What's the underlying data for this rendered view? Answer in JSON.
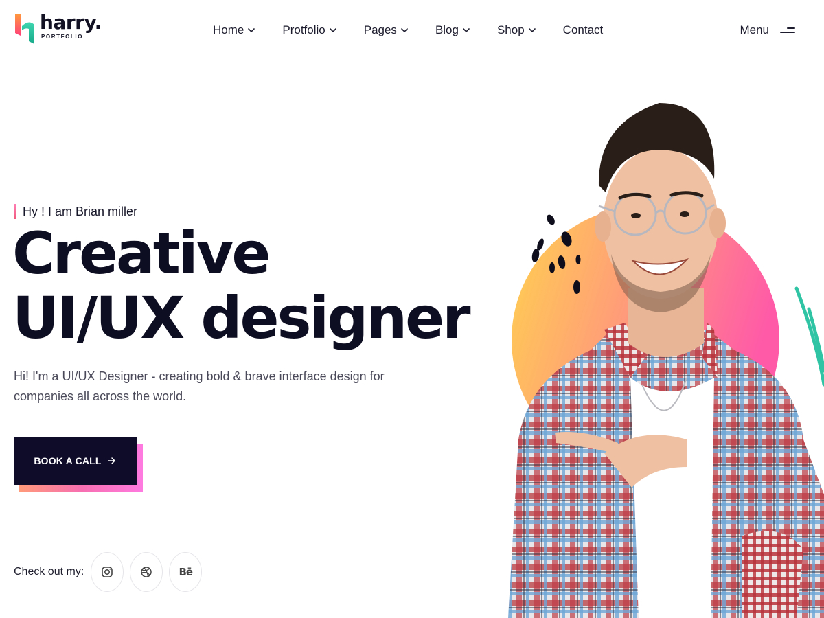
{
  "brand": {
    "name": "harry.",
    "tagline": "PORTFOLIO",
    "colors": {
      "mark_left": "#ff5a7a",
      "mark_right": "#24c2a0",
      "dark": "#0f0c29"
    }
  },
  "nav": {
    "items": [
      {
        "label": "Home",
        "has_dropdown": true
      },
      {
        "label": "Protfolio",
        "has_dropdown": true
      },
      {
        "label": "Pages",
        "has_dropdown": true
      },
      {
        "label": "Blog",
        "has_dropdown": true
      },
      {
        "label": "Shop",
        "has_dropdown": true
      },
      {
        "label": "Contact",
        "has_dropdown": false
      }
    ],
    "menu_label": "Menu"
  },
  "hero": {
    "greeting": "Hy ! I am Brian miller",
    "headline_line1": "Creative",
    "headline_line2": "UI/UX designer",
    "intro_line1": "Hi! I'm a UI/UX Designer - creating bold & brave interface design for",
    "intro_line2": "companies all across the world.",
    "cta_label": "BOOK A CALL",
    "cta_icon": "arrow-right-icon"
  },
  "social": {
    "label": "Check out my:",
    "links": [
      {
        "name": "instagram",
        "icon": "instagram-icon"
      },
      {
        "name": "dribbble",
        "icon": "dribbble-icon"
      },
      {
        "name": "behance",
        "icon": "behance-icon",
        "glyph": "Bē"
      }
    ]
  },
  "hero_image": {
    "subject": "smiling-man-pointing",
    "gradient_colors": [
      "#ffd56a",
      "#ff9a7a",
      "#ff5aa8"
    ],
    "accent_color": "#2ec4a4"
  }
}
